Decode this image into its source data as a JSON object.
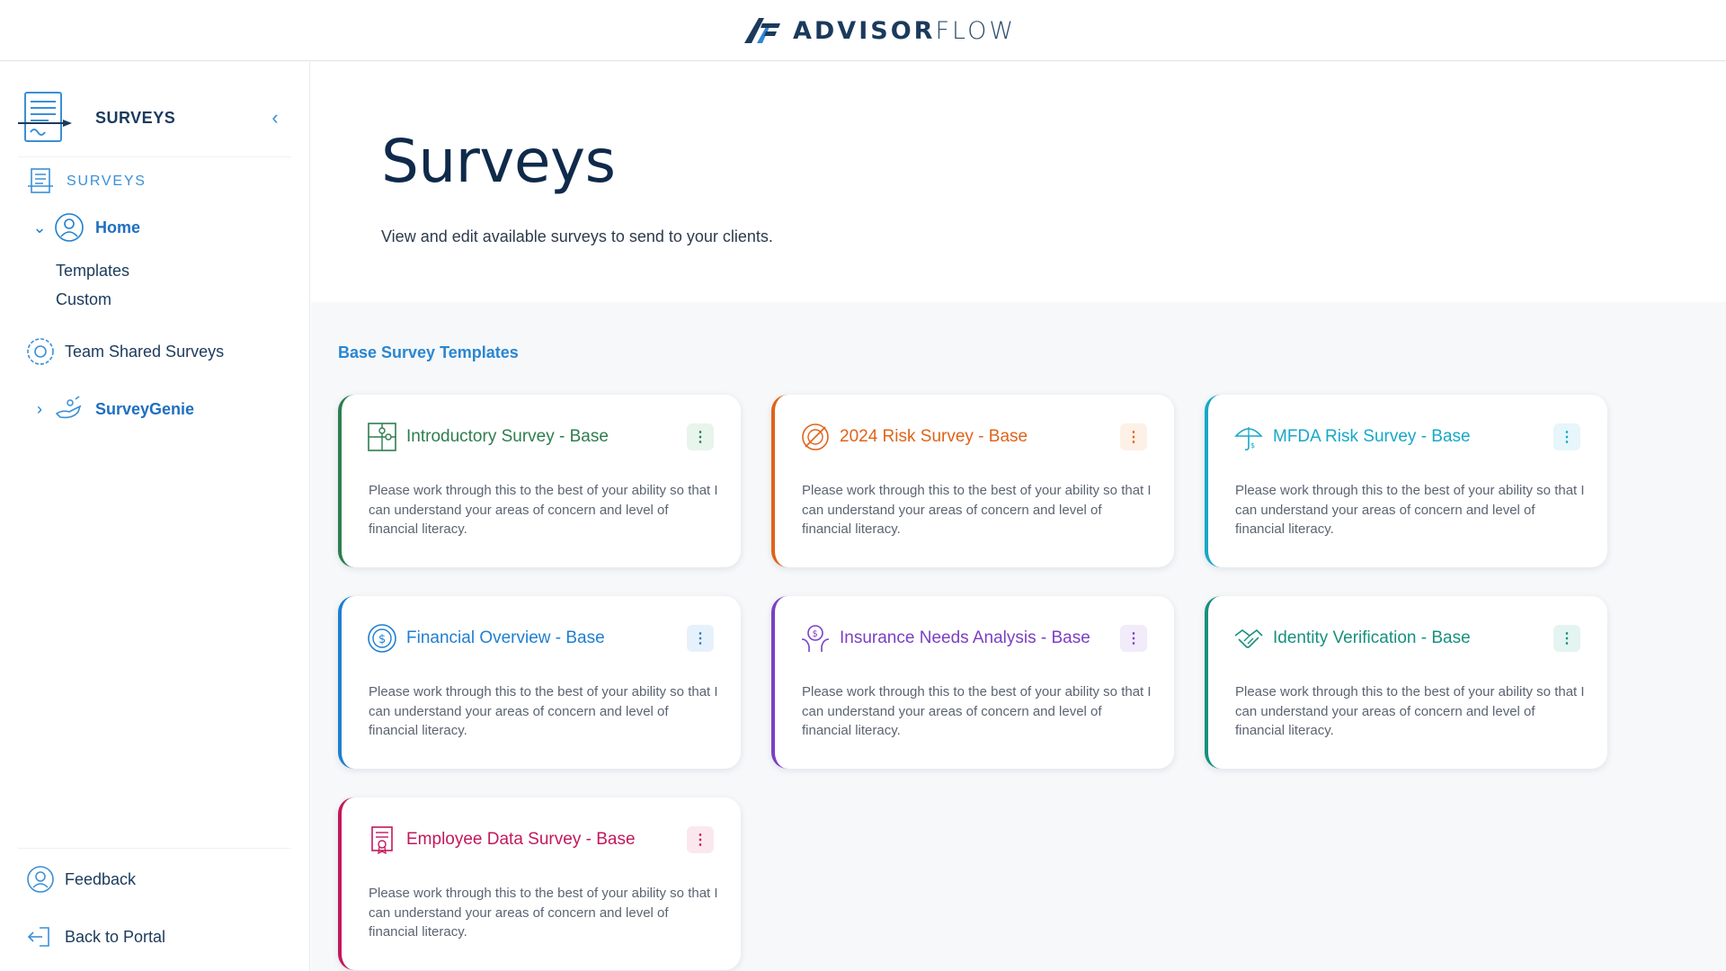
{
  "brand": {
    "name_bold": "ADVISOR",
    "name_light": "FLOW"
  },
  "sidebar": {
    "header_title": "SURVEYS",
    "section_label": "SURVEYS",
    "home_label": "Home",
    "sub_items": [
      "Templates",
      "Custom"
    ],
    "team_shared_label": "Team Shared Surveys",
    "surveygenie_label": "SurveyGenie",
    "feedback_label": "Feedback",
    "back_label": "Back to Portal"
  },
  "main": {
    "title": "Surveys",
    "subtitle": "View and edit available surveys to send to your clients.",
    "section_title": "Base Survey Templates",
    "menu_glyph": "⋮",
    "cards": [
      {
        "title": "Introductory Survey - Base",
        "desc": "Please work through this to the best of your ability so that I can understand your areas of concern and level of financial literacy.",
        "color": "#2e7d4f",
        "tint": "#e8f5ec",
        "icon": "puzzle-icon"
      },
      {
        "title": "2024 Risk Survey - Base",
        "desc": "Please work through this to the best of your ability so that I can understand your areas of concern and level of financial literacy.",
        "color": "#e0631a",
        "tint": "#fdf0e6",
        "icon": "risk-target-icon"
      },
      {
        "title": "MFDA Risk Survey - Base",
        "desc": "Please work through this to the best of your ability so that I can understand your areas of concern and level of financial literacy.",
        "color": "#17a8c7",
        "tint": "#e6f6fa",
        "icon": "umbrella-icon"
      },
      {
        "title": "Financial Overview - Base",
        "desc": "Please work through this to the best of your ability so that I can understand your areas of concern and level of financial literacy.",
        "color": "#1f7fd0",
        "tint": "#e7f1fb",
        "icon": "coin-icon"
      },
      {
        "title": "Insurance Needs Analysis - Base",
        "desc": "Please work through this to the best of your ability so that I can understand your areas of concern and level of financial literacy.",
        "color": "#7b3fc4",
        "tint": "#f2ebfa",
        "icon": "hands-coin-icon"
      },
      {
        "title": "Identity Verification - Base",
        "desc": "Please work through this to the best of your ability so that I can understand your areas of concern and level of financial literacy.",
        "color": "#16907f",
        "tint": "#e4f4f1",
        "icon": "handshake-icon"
      },
      {
        "title": "Employee Data Survey - Base",
        "desc": "Please work through this to the best of your ability so that I can understand your areas of concern and level of financial literacy.",
        "color": "#c2185b",
        "tint": "#fbe8ef",
        "icon": "certificate-icon"
      }
    ]
  }
}
